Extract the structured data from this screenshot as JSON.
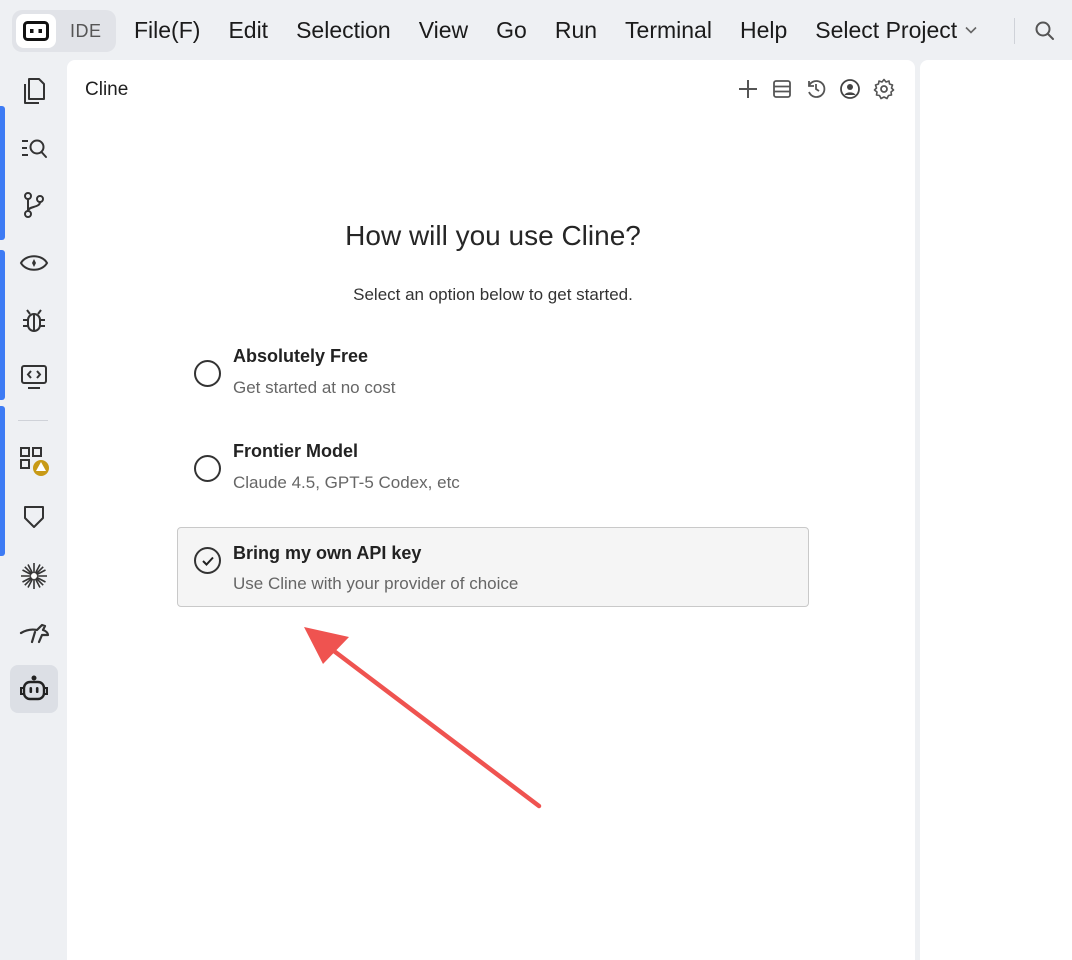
{
  "menubar": {
    "ide_label": "IDE",
    "items": [
      "File(F)",
      "Edit",
      "Selection",
      "View",
      "Go",
      "Run",
      "Terminal",
      "Help"
    ],
    "project_label": "Select Project"
  },
  "activity_bar": {
    "icons": [
      "explorer-icon",
      "search-icon",
      "source-control-icon",
      "preview-icon",
      "debug-icon",
      "remote-explorer-icon",
      "extensions-icon",
      "shield-icon",
      "asterisk-icon",
      "kangaroo-icon",
      "cline-bot-icon"
    ],
    "active": "cline-bot-icon"
  },
  "panel": {
    "title": "Cline",
    "actions": [
      "plus-icon",
      "history-list-icon",
      "history-icon",
      "account-icon",
      "settings-icon"
    ]
  },
  "welcome": {
    "heading": "How will you use Cline?",
    "subheading": "Select an option below to get started.",
    "options": [
      {
        "title": "Absolutely Free",
        "description": "Get started at no cost",
        "selected": false
      },
      {
        "title": "Frontier Model",
        "description": "Claude 4.5, GPT-5 Codex, etc",
        "selected": false
      },
      {
        "title": "Bring my own API key",
        "description": "Use Cline with your provider of choice",
        "selected": true
      }
    ]
  },
  "colors": {
    "accent": "#3d7bf4",
    "annotation_arrow": "#ef5350",
    "badge": "#c89a16"
  }
}
